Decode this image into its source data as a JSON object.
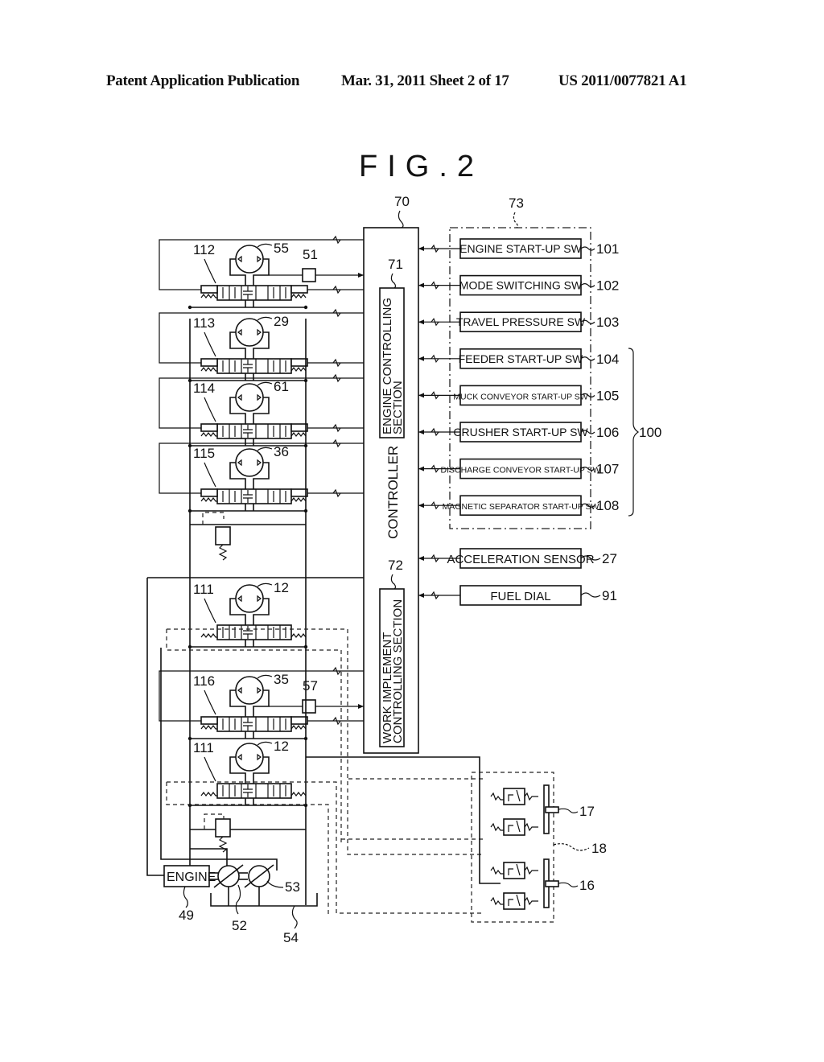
{
  "header": {
    "left": "Patent Application Publication",
    "middle": "Mar. 31, 2011  Sheet 2 of 17",
    "right": "US 2011/0077821 A1"
  },
  "figure": {
    "title": "FIG.2",
    "controller": {
      "ref": "70",
      "label": "CONTROLLER",
      "engine_section": {
        "ref": "71",
        "line1": "ENGINE CONTROLLING",
        "line2": "SECTION"
      },
      "work_section": {
        "ref": "72",
        "line1": "WORK IMPLEMENT",
        "line2": "CONTROLLING SECTION"
      }
    },
    "switch_group": {
      "ref": "73",
      "bracket_ref": "100"
    },
    "switches": [
      {
        "label": "ENGINE START-UP SW",
        "ref": "101"
      },
      {
        "label": "MODE SWITCHING SW",
        "ref": "102"
      },
      {
        "label": "TRAVEL PRESSURE SW",
        "ref": "103"
      },
      {
        "label": "FEEDER START-UP SW",
        "ref": "104"
      },
      {
        "label": "MUCK CONVEYOR START-UP SW",
        "ref": "105"
      },
      {
        "label": "CRUSHER START-UP SW",
        "ref": "106"
      },
      {
        "label": "DISCHARGE CONVEYOR START-UP SW",
        "ref": "107"
      },
      {
        "label": "MAGNETIC SEPARATOR START-UP SW",
        "ref": "108"
      }
    ],
    "sensors": [
      {
        "label": "ACCELERATION SENSOR",
        "ref": "27"
      },
      {
        "label": "FUEL DIAL",
        "ref": "91"
      }
    ],
    "valve_units": [
      {
        "valve_ref": "112",
        "motor_ref": "55"
      },
      {
        "valve_ref": "113",
        "motor_ref": "29"
      },
      {
        "valve_ref": "114",
        "motor_ref": "61"
      },
      {
        "valve_ref": "115",
        "motor_ref": "36"
      },
      {
        "valve_ref": "111",
        "motor_ref": "12"
      },
      {
        "valve_ref": "116",
        "motor_ref": "35"
      },
      {
        "valve_ref": "111",
        "motor_ref": "12"
      }
    ],
    "sensor_boxes": [
      {
        "ref": "51"
      },
      {
        "ref": "57"
      }
    ],
    "engine": {
      "label": "ENGINE",
      "ref": "49"
    },
    "pumps": [
      {
        "ref": "52"
      },
      {
        "ref": "53"
      }
    ],
    "tank": {
      "ref": "54"
    },
    "levers": [
      {
        "ref": "17"
      },
      {
        "ref": "16"
      }
    ],
    "pilot_block": {
      "ref": "18"
    }
  }
}
